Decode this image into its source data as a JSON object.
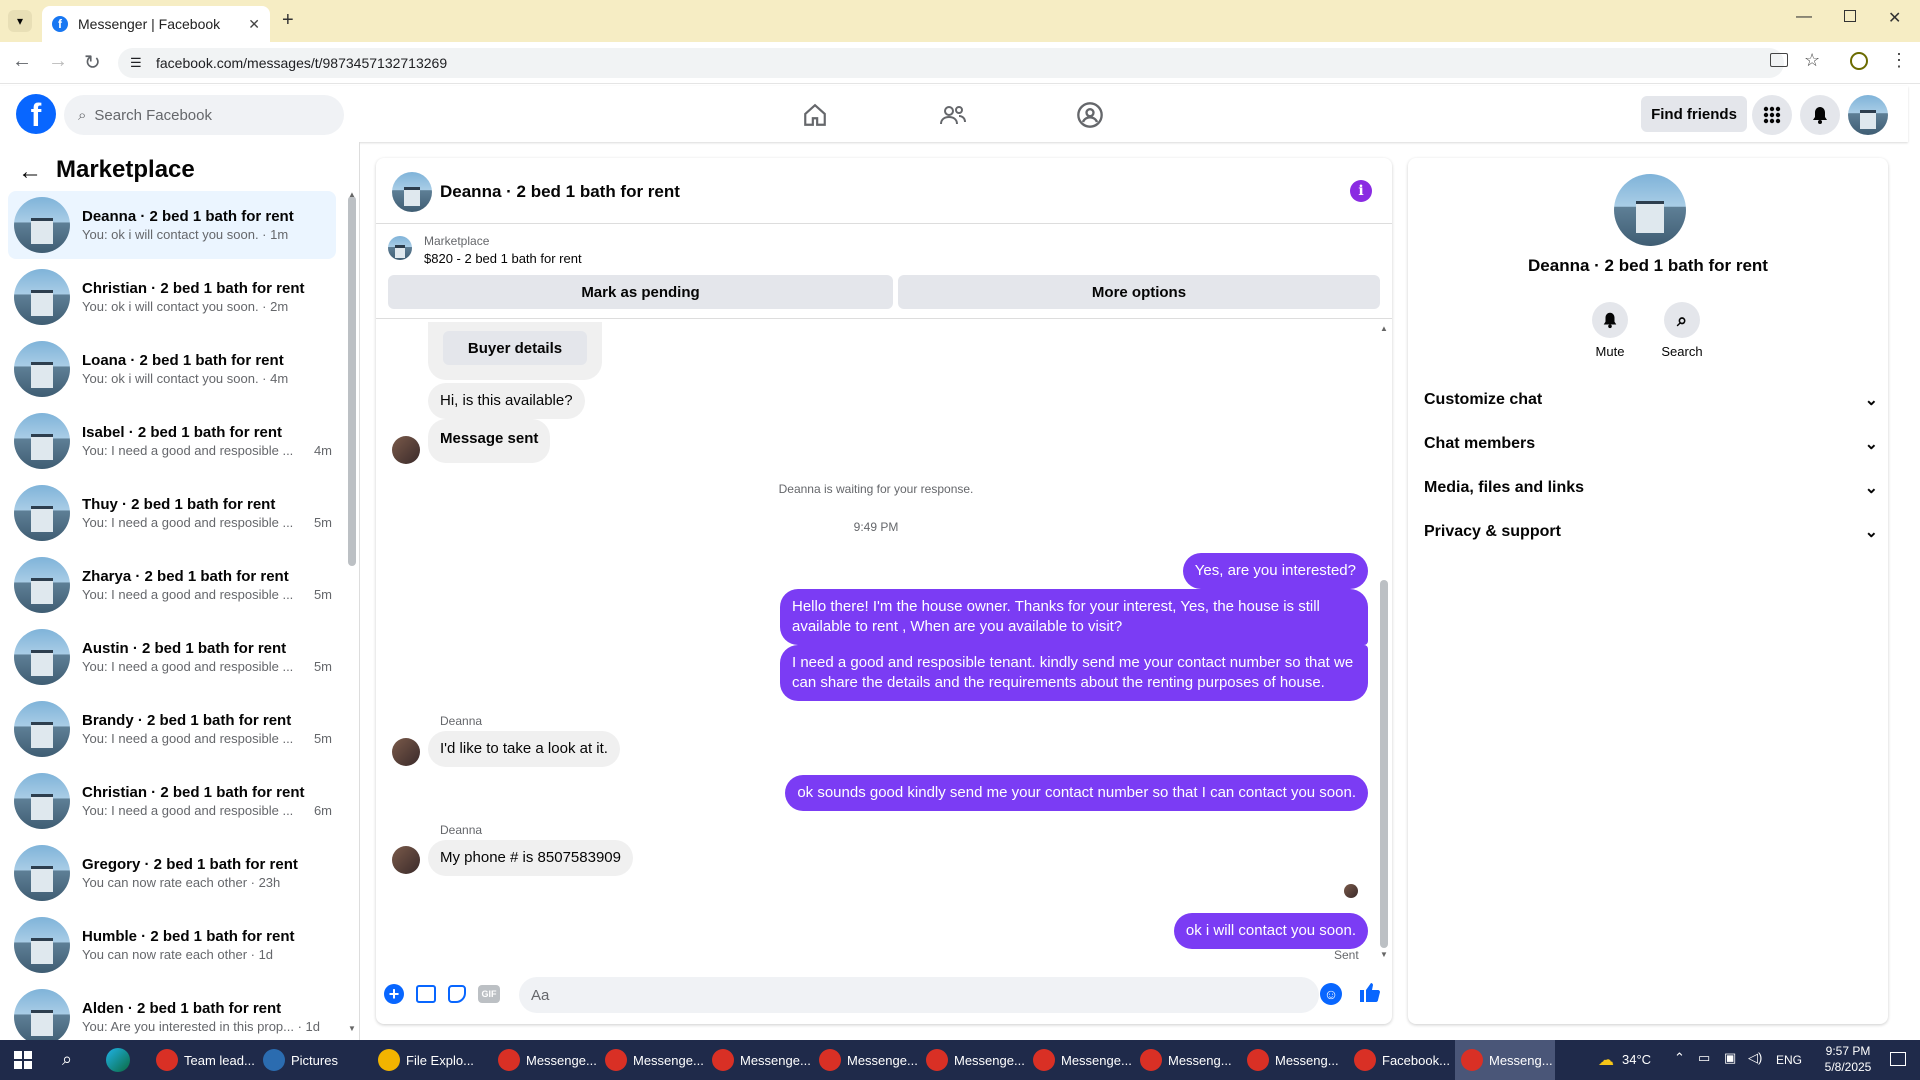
{
  "browser": {
    "tab_title": "Messenger | Facebook",
    "url": "facebook.com/messages/t/9873457132713269"
  },
  "fb": {
    "search_placeholder": "Search Facebook",
    "find_friends": "Find friends"
  },
  "sidebar": {
    "title": "Marketplace",
    "conversations": [
      {
        "name": "Deanna · 2 bed 1 bath for rent",
        "preview": "You: ok i will contact you soon. · 1m",
        "active": true
      },
      {
        "name": "Christian · 2 bed 1 bath for rent",
        "preview": "You: ok i will contact you soon. · 2m"
      },
      {
        "name": "Loana · 2 bed 1 bath for rent",
        "preview": "You: ok i will contact you soon. · 4m"
      },
      {
        "name": "Isabel · 2 bed 1 bath for rent",
        "preview": "You: I need a good and resposible ...",
        "time": "4m"
      },
      {
        "name": "Thuy · 2 bed 1 bath for rent",
        "preview": "You: I need a good and resposible ...",
        "time": "5m"
      },
      {
        "name": "Zharya · 2 bed 1 bath for rent",
        "preview": "You: I need a good and resposible ...",
        "time": "5m"
      },
      {
        "name": "Austin · 2 bed 1 bath for rent",
        "preview": "You: I need a good and resposible ...",
        "time": "5m"
      },
      {
        "name": "Brandy · 2 bed 1 bath for rent",
        "preview": "You: I need a good and resposible ...",
        "time": "5m"
      },
      {
        "name": "Christian · 2 bed 1 bath for rent",
        "preview": "You: I need a good and resposible ...",
        "time": "6m"
      },
      {
        "name": "Gregory · 2 bed 1 bath for rent",
        "preview": "You can now rate each other · 23h"
      },
      {
        "name": "Humble · 2 bed 1 bath for rent",
        "preview": "You can now rate each other · 1d"
      },
      {
        "name": "Alden · 2 bed 1 bath for rent",
        "preview": "You: Are you interested in this prop... · 1d"
      }
    ]
  },
  "chat": {
    "title": "Deanna · 2 bed 1 bath for rent",
    "listing_source": "Marketplace",
    "listing_title": "$820 - 2 bed 1 bath for rent",
    "mark_pending": "Mark as pending",
    "more_options": "More options",
    "buyer_details": "Buyer details",
    "msg_available": "Hi, is this available?",
    "msg_sent": "Message sent",
    "waiting": "Deanna is waiting for your response.",
    "time": "9:49 PM",
    "out1": "Yes, are you interested?",
    "out2": "Hello there! I'm the house owner. Thanks for your interest, Yes, the house is still available to rent , When are you available to visit?",
    "out3": "I need a good and resposible tenant.  kindly send me your contact number so that we can share the details and the requirements about the renting purposes of house.",
    "sender1": "Deanna",
    "in1": "I'd like to take a look at it.",
    "out4": "ok sounds good kindly send me your contact number so that I can contact you soon.",
    "sender2": "Deanna",
    "in2": "My phone # is 8507583909",
    "out5": "ok i will contact you soon.",
    "sent_status": "Sent",
    "composer_placeholder": "Aa"
  },
  "details": {
    "name": "Deanna · 2 bed 1 bath for rent",
    "mute": "Mute",
    "search": "Search",
    "sections": [
      "Customize chat",
      "Chat members",
      "Media, files and links",
      "Privacy & support"
    ]
  },
  "taskbar": {
    "items": [
      "Team lead...",
      "Pictures",
      "File Explo...",
      "Messenge...",
      "Messenge...",
      "Messenge...",
      "Messenge...",
      "Messenge...",
      "Messenge...",
      "Messeng...",
      "Messeng...",
      "Facebook...",
      "Messeng..."
    ],
    "weather": "34°C",
    "lang": "ENG",
    "time": "9:57 PM",
    "date": "5/8/2025"
  },
  "colors": {
    "accent": "#7b3cf4",
    "fb_blue": "#0866ff"
  }
}
